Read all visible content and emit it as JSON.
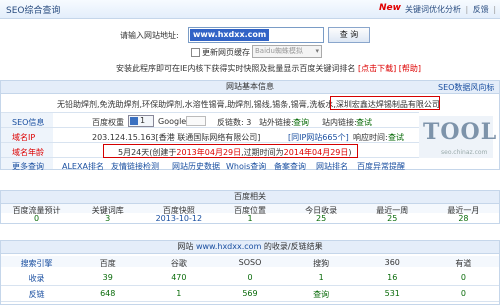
{
  "header": {
    "title": "SEO综合查询",
    "new_badge": "New",
    "link_history": "关键词优化分析",
    "link_feedback": "反馈",
    "link_close": "关闭"
  },
  "query": {
    "label": "请输入网站地址:",
    "url_value": "www.hxdxx.com",
    "search_button": "查 询",
    "update_label": "更新网页缓存",
    "engine_select": "Baidu蜘蛛模拟",
    "ie_tip": "安装此程序即可在IE内核下获得实时快照及批量显示百度关键词排名",
    "ie_link": "[点击下载]",
    "help_link": "[帮助]"
  },
  "basic": {
    "section_title": "网站基本信息",
    "seo_flow_link": "SEO数据风向标",
    "keywords": "无铅助焊剂,免洗助焊剂,环保助焊剂,水溶性锡膏,助焊剂,锡线,锡条,锡膏,洗板水,",
    "company": "深圳宏鑫达焊锡制品有限公司",
    "seo_info_label": "SEO信息",
    "baidu_weight_label": "百度权重",
    "baidu_weight_value": "1",
    "google_label": "Google",
    "google_value": "",
    "backlinks_label": "反链数:",
    "backlinks_value": "3",
    "outlinks_label": "站外链接:",
    "outlinks_value": "查询",
    "inlinks_label": "站内链接:",
    "inlinks_value": "查试",
    "ip_label": "域名IP",
    "ip_value": "203.124.15.163",
    "ip_location": "[香港 联通国际网络有限公司]",
    "same_ip_label": "[同IP网站665个]",
    "response_label": "响应时间:",
    "response_value": "查试",
    "age_label": "域名年龄",
    "age_value": "5月24天",
    "age_detail_prefix": "(创建于",
    "age_created": "2013年04月29日",
    "age_detail_mid": ",过期时间为",
    "age_expire": "2014年04月29日",
    "age_detail_suffix": ")",
    "more_label": "更多查询",
    "more_links": [
      "ALEXA排名",
      "友情链接检测",
      "网站历史数据",
      "Whois查询",
      "备案查询",
      "网站排名",
      "百度异常提醒"
    ],
    "logo_text": "TOOL",
    "logo_sub": "seo.chinaz.com"
  },
  "baidu": {
    "section_title": "百度相关",
    "headers": [
      "百度流量预计",
      "关键词库",
      "百度快照",
      "百度位置",
      "今日收录",
      "最近一周",
      "最近一月"
    ],
    "values": [
      "0",
      "3",
      "2013-10-12",
      "1",
      "25",
      "25",
      "28"
    ]
  },
  "index": {
    "section_prefix": "网站 ",
    "section_domain": "www.hxdxx.com",
    "section_suffix": " 的收录/反链结果",
    "headers": [
      "搜索引擎",
      "百度",
      "谷歌",
      "SOSO",
      "搜狗",
      "360",
      "有道"
    ],
    "rows": [
      {
        "label": "收录",
        "values": [
          "39",
          "470",
          "0",
          "1",
          "16",
          "0"
        ]
      },
      {
        "label": "反链",
        "values": [
          "648",
          "1",
          "569",
          "查询",
          "531",
          "0"
        ]
      }
    ]
  }
}
